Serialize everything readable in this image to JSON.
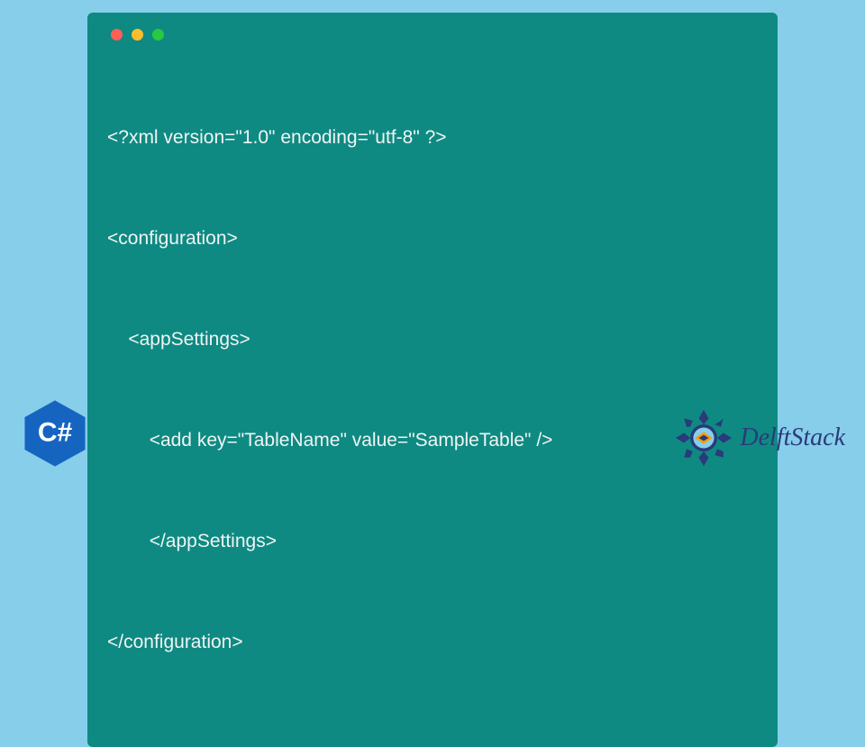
{
  "code": {
    "lines": [
      "<?xml version=\"1.0\" encoding=\"utf-8\" ?>",
      "<configuration>",
      "    <appSettings>",
      "    \t<add key=\"TableName\" value=\"SampleTable\" />",
      "   \t</appSettings>",
      "</configuration>"
    ]
  },
  "badge": {
    "label": "C#",
    "hexFill": "#1565c0"
  },
  "brand": {
    "name": "DelftStack",
    "ornamentColor": "#2a3a7a",
    "accentColor": "#f59e0b"
  },
  "colors": {
    "pageBg": "#87ceeb",
    "codeBg": "#0e8a82",
    "codeText": "#f0f4f4"
  }
}
